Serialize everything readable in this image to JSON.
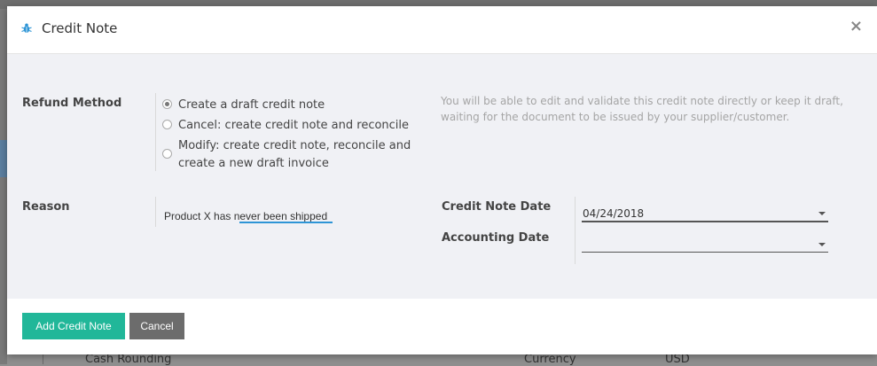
{
  "background": {
    "footer_left_text": "Cash Rounding",
    "footer_mid_text": "Currency",
    "footer_right_text": "USD"
  },
  "modal": {
    "title": "Credit Note",
    "icon": "bug-icon",
    "close_label": "×",
    "refund_method_label": "Refund Method",
    "refund_options": [
      {
        "label": "Create a draft credit note",
        "checked": true
      },
      {
        "label": "Cancel: create credit note and reconcile",
        "checked": false
      },
      {
        "label": "Modify: create credit note, reconcile and create a new draft invoice",
        "checked": false
      }
    ],
    "help_text": "You will be able to edit and validate this credit note directly or keep it draft, waiting for the document to be issued by your supplier/customer.",
    "reason_label": "Reason",
    "reason_value": "Product X has never been shipped",
    "credit_note_date_label": "Credit Note Date",
    "credit_note_date_value": "04/24/2018",
    "accounting_date_label": "Accounting Date",
    "accounting_date_value": "",
    "add_button_label": "Add Credit Note",
    "cancel_button_label": "Cancel"
  },
  "colors": {
    "primary": "#21b799",
    "secondary": "#6c6c6c",
    "focus": "#2e95d6",
    "body_bg": "#f0f1f5"
  }
}
